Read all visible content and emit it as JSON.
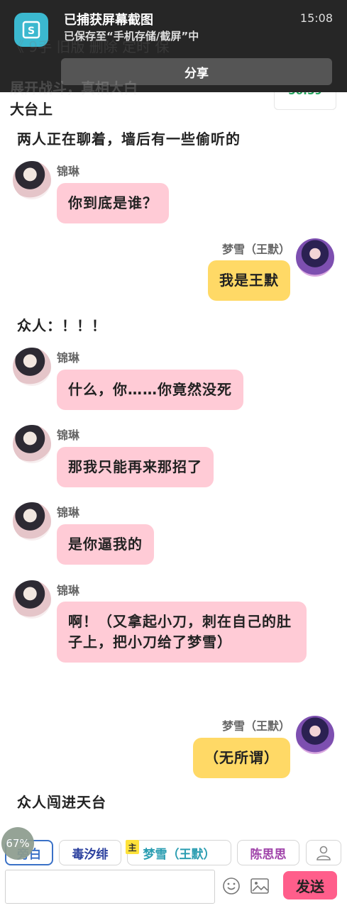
{
  "notification": {
    "title": "已捕获屏幕截图",
    "subtitle": "已保存至“手机存储/截屏”中",
    "time": "15:08",
    "share_label": "分享"
  },
  "underlay": {
    "header_text": "《 9手    旧版  删除  定时  保",
    "subtitle_text": "展开战斗，真相大白",
    "call_timer": "56:59"
  },
  "scene_line": "大台上",
  "messages": [
    {
      "type": "narration",
      "text": "两人正在聊着，墙后有一些偷听的"
    },
    {
      "type": "left",
      "name": "锦琳",
      "text": "你到底是谁？"
    },
    {
      "type": "right",
      "name": "梦雪（王默）",
      "text": "我是王默"
    },
    {
      "type": "narration",
      "text": "众人：！！！"
    },
    {
      "type": "left",
      "name": "锦琳",
      "text": "什么，你……你竟然没死"
    },
    {
      "type": "left",
      "name": "锦琳",
      "text": "那我只能再来那招了"
    },
    {
      "type": "left",
      "name": "锦琳",
      "text": "是你逼我的"
    },
    {
      "type": "left",
      "name": "锦琳",
      "text": "啊！（又拿起小刀，刺在自己的肚子上，把小刀给了梦雪）"
    },
    {
      "type": "right",
      "name": "梦雪（王默）",
      "text": "（无所谓）"
    },
    {
      "type": "narration",
      "text": "众人闯进天台"
    }
  ],
  "input_area": {
    "progress_badge": "67%",
    "roles": {
      "narration": "旁白",
      "du": "毒汐绯",
      "meng": "梦雪（王默）",
      "chen": "陈思思"
    },
    "host_tag": "主",
    "text_value": "",
    "send_label": "发送"
  },
  "colors": {
    "left_bubble": "#ffcbd6",
    "right_bubble": "#ffd966",
    "send_button": "#ff5e8b"
  }
}
